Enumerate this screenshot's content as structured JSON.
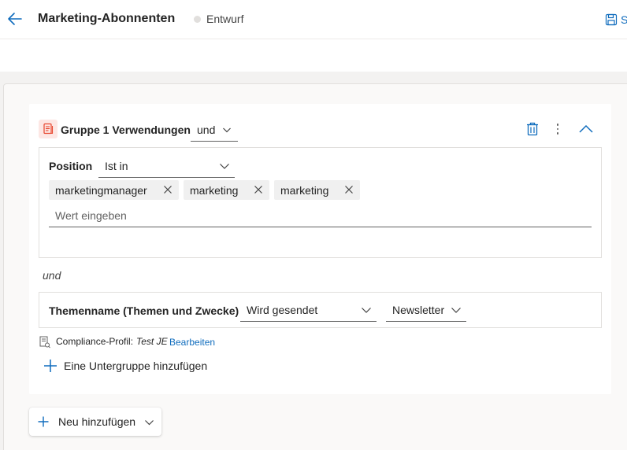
{
  "header": {
    "title": "Marketing-Abonnenten",
    "status": "Entwurf",
    "save_label": "S"
  },
  "group": {
    "title": "Gruppe 1 Verwendungen",
    "operator": "und"
  },
  "condition1": {
    "field_label": "Position",
    "operator": "Ist in",
    "tags": [
      "marketingmanager",
      "marketing",
      "marketing"
    ],
    "value_placeholder": "Wert eingeben"
  },
  "separator": "und",
  "condition2": {
    "field_label": "Themenname (Themen und Zwecke)",
    "operator": "Wird gesendet",
    "value": "Newsletter"
  },
  "compliance": {
    "label": "Compliance-Profil:",
    "value": "Test JE",
    "edit_label": "Bearbeiten"
  },
  "add_subgroup_label": "Eine Untergruppe hinzufügen",
  "add_new_label": "Neu hinzufügen",
  "colors": {
    "accent": "#0f6cbd",
    "group_icon": "#e8472f",
    "canvas": "#f3f2f1"
  }
}
